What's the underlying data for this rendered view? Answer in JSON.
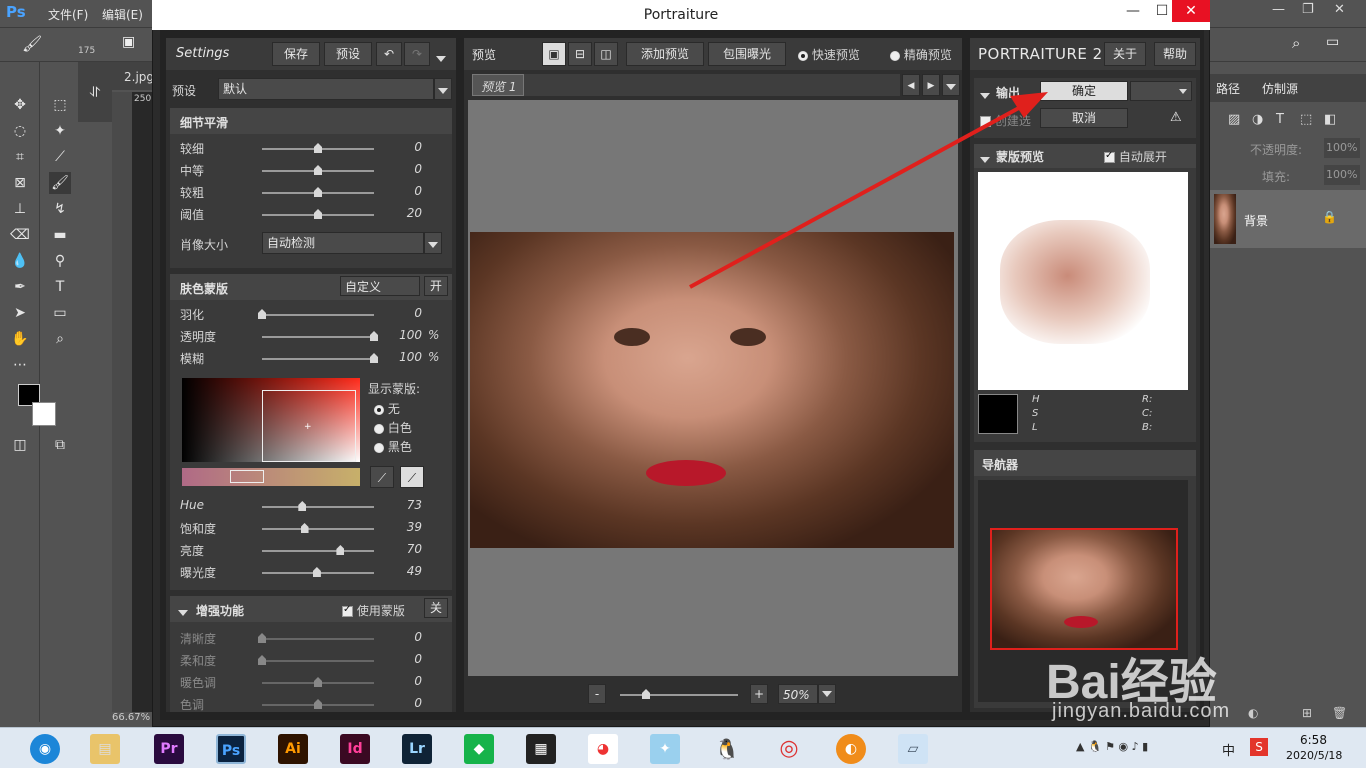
{
  "ps": {
    "logo": "Ps",
    "menu": [
      "文件(F)",
      "编辑(E)"
    ],
    "doc_tab": "2.jpg",
    "zoom_status": "66.67%",
    "brush_size": "175",
    "ruler_mark": "250",
    "right_tabs": [
      "路径",
      "仿制源"
    ],
    "opacity_label": "不透明度:",
    "opacity_value": "100%",
    "fill_label": "填充:",
    "fill_value": "100%",
    "layer_name": "背景"
  },
  "dialog": {
    "title": "Portraiture",
    "settings": {
      "title": "Settings",
      "save": "保存",
      "preset_btn": "预设",
      "preset_label": "预设",
      "preset_value": "默认"
    },
    "detail": {
      "title": "细节平滑",
      "rows": [
        {
          "label": "较细",
          "value": "0",
          "pos": 0.5
        },
        {
          "label": "中等",
          "value": "0",
          "pos": 0.5
        },
        {
          "label": "较粗",
          "value": "0",
          "pos": 0.5
        },
        {
          "label": "阈值",
          "value": "20",
          "pos": 0.5
        }
      ],
      "portrait_size_label": "肖像大小",
      "portrait_size_value": "自动检测"
    },
    "skin": {
      "title": "肤色蒙版",
      "mode": "自定义",
      "toggle": "开",
      "rows": [
        {
          "label": "羽化",
          "value": "0",
          "unit": "",
          "pos": 0.0
        },
        {
          "label": "透明度",
          "value": "100",
          "unit": "%",
          "pos": 1.0
        },
        {
          "label": "模糊",
          "value": "100",
          "unit": "%",
          "pos": 1.0
        }
      ],
      "show_mask_label": "显示蒙版:",
      "show_mask_options": [
        "无",
        "白色",
        "黑色"
      ],
      "hsl_rows": [
        {
          "label": "Hue",
          "value": "73",
          "pos": 0.36
        },
        {
          "label": "饱和度",
          "value": "39",
          "pos": 0.38
        },
        {
          "label": "亮度",
          "value": "70",
          "pos": 0.7
        },
        {
          "label": "曝光度",
          "value": "49",
          "pos": 0.49
        }
      ]
    },
    "enhance": {
      "title": "增强功能",
      "use_mask": "使用蒙版",
      "toggle": "关",
      "rows": [
        {
          "label": "清晰度",
          "value": "0",
          "pos": 0.0
        },
        {
          "label": "柔和度",
          "value": "0",
          "pos": 0.0
        },
        {
          "label": "暖色调",
          "value": "0",
          "pos": 0.5
        },
        {
          "label": "色调",
          "value": "0",
          "pos": 0.5
        }
      ]
    },
    "preview": {
      "title": "预览",
      "add_preview": "添加预览",
      "bracket": "包围曝光",
      "fast": "快速预览",
      "accurate": "精确预览",
      "tab": "预览 1",
      "zoom": "50%",
      "minus": "-",
      "plus": "+"
    },
    "right": {
      "brand": "PORTRAITURE 2",
      "about": "关于",
      "help": "帮助",
      "output_title": "输出",
      "ok": "确定",
      "cancel": "取消",
      "new_layer": "创建选",
      "mask_preview_title": "蒙版预览",
      "auto_expand": "自动展开",
      "hsl_left": [
        "H",
        "S",
        "L"
      ],
      "hsl_right": [
        "R:",
        "C:",
        "B:"
      ],
      "navigator_title": "导航器"
    }
  },
  "taskbar": {
    "apps": [
      "Pr",
      "Ps",
      "Ai",
      "Id",
      "Lr"
    ],
    "time": "6:58",
    "date": "2020/5/18",
    "ime": "中"
  },
  "watermark": {
    "brand": "Bai经验",
    "url": "jingyan.baidu.com"
  },
  "colors": {
    "arrow": "#e0201c",
    "ps_accent": "#4aa3ff",
    "lips": "#b8182a"
  }
}
